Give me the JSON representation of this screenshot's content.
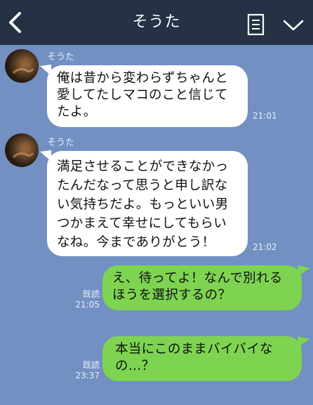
{
  "header": {
    "title": "そうた",
    "back_icon": "chevron-left-icon",
    "menu_icon": "notes-icon",
    "expand_icon": "chevron-down-icon"
  },
  "messages": [
    {
      "sender": "そうた",
      "text": "俺は昔から変わらずちゃんと愛してたしマコのこと信じてたよ。",
      "time": "21:01"
    },
    {
      "sender": "そうた",
      "text": "満足させることができなかったんだなって思うと申し訳ない気持ちだよ。もっといい男つかまえて幸せにしてもらいなね。今までありがとう！",
      "time": "21:02"
    },
    {
      "text": "え、待ってよ！なんで別れるほうを選択するの？",
      "read": "既読",
      "time": "21:05"
    },
    {
      "text": "本当にこのままバイバイなの…？",
      "read": "既読",
      "time": "23:37"
    }
  ],
  "colors": {
    "background": "#7290c2",
    "header": "#253245",
    "incoming_bubble": "#ffffff",
    "outgoing_bubble": "#7ed451"
  }
}
